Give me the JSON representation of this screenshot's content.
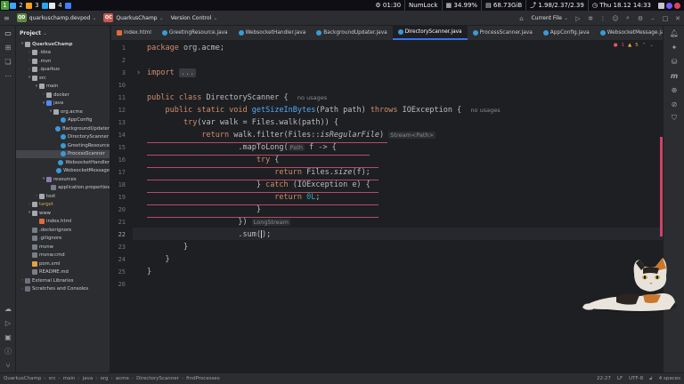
{
  "system_bar": {
    "workspaces": [
      "1",
      "2",
      "3",
      "4"
    ],
    "time": "01:30",
    "numlock": "NumLock",
    "cpu": "34.99%",
    "memory": "68.73GiB",
    "load": "1.98/2.37/2.39",
    "datetime": "Thu 18.12 14:33"
  },
  "titlebar": {
    "project_badge": "QD",
    "project_name": "quarkuschamp.devpod",
    "app_badge": "QC",
    "app_name": "QuarkusChamp",
    "vcs": "Version Control",
    "run_config": "Current File"
  },
  "project_panel": {
    "title": "Project",
    "items": [
      {
        "label": "QuarkusChamp",
        "indent": 1,
        "icon": "folder",
        "arrow": "▾",
        "bold": true
      },
      {
        "label": ".idea",
        "indent": 2,
        "icon": "folder",
        "arrow": "›"
      },
      {
        "label": ".mvn",
        "indent": 2,
        "icon": "folder",
        "arrow": "›"
      },
      {
        "label": ".quarkus",
        "indent": 2,
        "icon": "folder",
        "arrow": "›"
      },
      {
        "label": "src",
        "indent": 2,
        "icon": "folder",
        "arrow": "▾"
      },
      {
        "label": "main",
        "indent": 3,
        "icon": "folder",
        "arrow": "▾"
      },
      {
        "label": "docker",
        "indent": 4,
        "icon": "folder",
        "arrow": "›"
      },
      {
        "label": "java",
        "indent": 4,
        "icon": "src",
        "arrow": "▾"
      },
      {
        "label": "org.acme",
        "indent": 5,
        "icon": "folder",
        "arrow": "▾"
      },
      {
        "label": "AppConfig",
        "indent": 6,
        "icon": "java",
        "arrow": ""
      },
      {
        "label": "BackgroundUpdater",
        "indent": 6,
        "icon": "java",
        "arrow": ""
      },
      {
        "label": "DirectoryScanner",
        "indent": 6,
        "icon": "java",
        "arrow": ""
      },
      {
        "label": "GreetingResource",
        "indent": 6,
        "icon": "java",
        "arrow": ""
      },
      {
        "label": "ProcessScanner",
        "indent": 6,
        "icon": "java",
        "arrow": "",
        "selected": true
      },
      {
        "label": "WebsocketHandler",
        "indent": 6,
        "icon": "java",
        "arrow": ""
      },
      {
        "label": "WebsocketMessage",
        "indent": 6,
        "icon": "java",
        "arrow": ""
      },
      {
        "label": "resources",
        "indent": 4,
        "icon": "res",
        "arrow": "▾"
      },
      {
        "label": "application.properties",
        "indent": 5,
        "icon": "file",
        "arrow": ""
      },
      {
        "label": "test",
        "indent": 3,
        "icon": "folder",
        "arrow": "›"
      },
      {
        "label": "target",
        "indent": 2,
        "icon": "folder",
        "arrow": "›",
        "hl": true
      },
      {
        "label": "www",
        "indent": 2,
        "icon": "folder",
        "arrow": "▾"
      },
      {
        "label": "index.html",
        "indent": 3,
        "icon": "html",
        "arrow": ""
      },
      {
        "label": ".dockerignore",
        "indent": 2,
        "icon": "file",
        "arrow": ""
      },
      {
        "label": ".gitignore",
        "indent": 2,
        "icon": "file",
        "arrow": ""
      },
      {
        "label": "mvnw",
        "indent": 2,
        "icon": "file",
        "arrow": ""
      },
      {
        "label": "mvnw.cmd",
        "indent": 2,
        "icon": "file",
        "arrow": ""
      },
      {
        "label": "pom.xml",
        "indent": 2,
        "icon": "xml",
        "arrow": ""
      },
      {
        "label": "README.md",
        "indent": 2,
        "icon": "file",
        "arrow": ""
      },
      {
        "label": "External Libraries",
        "indent": 1,
        "icon": "lib",
        "arrow": "›"
      },
      {
        "label": "Scratches and Consoles",
        "indent": 1,
        "icon": "lib",
        "arrow": "›"
      }
    ]
  },
  "tabs": [
    {
      "label": "index.html",
      "icon": "html"
    },
    {
      "label": "GreetingResource.java",
      "icon": "java"
    },
    {
      "label": "WebsocketHandler.java",
      "icon": "java"
    },
    {
      "label": "BackgroundUpdater.java",
      "icon": "java"
    },
    {
      "label": "DirectoryScanner.java",
      "icon": "java",
      "active": true
    },
    {
      "label": "ProcessScanner.java",
      "icon": "java"
    },
    {
      "label": "AppConfig.java",
      "icon": "java"
    },
    {
      "label": "WebsocketMessage.java",
      "icon": "java"
    }
  ],
  "editor": {
    "inspection_errors": "1",
    "inspection_warnings": "5",
    "line_numbers": [
      "1",
      "2",
      "3",
      "10",
      "11",
      "12",
      "13",
      "14",
      "15",
      "16",
      "17",
      "18",
      "19",
      "20",
      "21",
      "22",
      "23",
      "24",
      "25",
      "26"
    ],
    "current_line": "22",
    "code": {
      "l1_kw": "package",
      "l1_rest": " org.acme;",
      "l3_kw": "import",
      "l3_fold": "...",
      "l11_kw": "public class",
      "l11_cls": " DirectoryScanner",
      "l11_rest": " {",
      "l11_hint": "no usages",
      "l12_kw1": "public static",
      "l12_t": " void ",
      "l12_fn": "getSizeInBytes",
      "l12_args": "(Path path) ",
      "l12_kw2": "throws",
      "l12_rest": " IOException {",
      "l12_hint": "no usages",
      "l13_kw": "try",
      "l13_rest": "(var walk = Files.walk(path)) {",
      "l14_kw": "return",
      "l14_rest": " walk.filter(Files::",
      "l14_it": "isRegularFile",
      "l14_end": ")",
      "l14_inlay": "Stream<Path>",
      "l15_rest": ".mapToLong(",
      "l15_inlay": "Path",
      "l15_end": " f -> {",
      "l16_kw": "try",
      "l16_rest": " {",
      "l17_kw": "return",
      "l17_rest": " Files.",
      "l17_it": "size",
      "l17_end": "(f);",
      "l18_a": "} ",
      "l18_kw": "catch",
      "l18_rest": " (IOException e) {",
      "l19_kw": "return",
      "l19_num": " 0L",
      "l19_end": ";",
      "l20": "}",
      "l21": "})",
      "l21_inlay": "LongStream",
      "l22": ".sum(",
      "l22_end": ");",
      "l23": "}",
      "l24": "}",
      "l25": "}"
    }
  },
  "status_bar": {
    "breadcrumbs": [
      "QuarkusChamp",
      "src",
      "main",
      "java",
      "org",
      "acme",
      "DirectoryScanner",
      "findProcesses"
    ],
    "position": "22:27",
    "line_sep": "LF",
    "encoding": "UTF-8",
    "indent": "4 spaces"
  },
  "colors": {
    "accent": "#3574f0",
    "warning_stripe": "#d1426b"
  }
}
